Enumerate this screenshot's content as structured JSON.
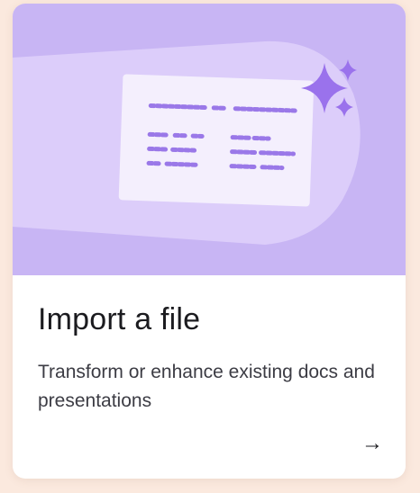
{
  "card": {
    "title": "Import a file",
    "description": "Transform or enhance existing docs and presentations",
    "arrow_icon": "arrow-right-icon",
    "arrow_glyph": "→"
  },
  "illustration": {
    "icons": [
      "document-icon",
      "sparkle-icon"
    ]
  },
  "colors": {
    "page_background": "#fbe9de",
    "hero_background": "#c8b5f4",
    "hero_beam": "#dccdfa",
    "document": "#f4effd",
    "scribble": "#9a78e8",
    "sparkle": "#9a72ec",
    "title_text": "#1b1b1f",
    "description_text": "#3c3c44"
  }
}
